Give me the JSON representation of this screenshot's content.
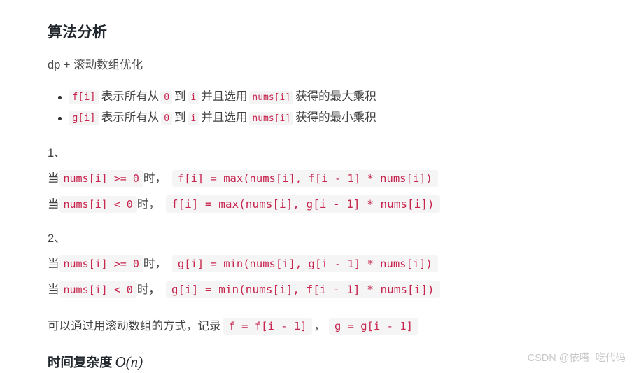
{
  "document": {
    "title": "算法分析",
    "subtitle": "dp + 滚动数组优化"
  },
  "definitions": [
    {
      "code": "f[i]",
      "text_1": "表示所有从",
      "code_from": "0",
      "text_2": "到",
      "code_to": "i",
      "text_3": "并且选用",
      "code_use": "nums[i]",
      "text_4": "获得的最大乘积"
    },
    {
      "code": "g[i]",
      "text_1": "表示所有从",
      "code_from": "0",
      "text_2": "到",
      "code_to": "i",
      "text_3": "并且选用",
      "code_use": "nums[i]",
      "text_4": "获得的最小乘积"
    }
  ],
  "sections": [
    {
      "label": "1、",
      "cases": [
        {
          "prefix": "当",
          "condition": "nums[i] >= 0",
          "middle": "时，",
          "formula": "f[i] = max(nums[i], f[i - 1] * nums[i])"
        },
        {
          "prefix": "当",
          "condition": "nums[i] < 0",
          "middle": "时，",
          "formula": "f[i] = max(nums[i], g[i - 1] * nums[i])"
        }
      ]
    },
    {
      "label": "2、",
      "cases": [
        {
          "prefix": "当",
          "condition": "nums[i] >= 0",
          "middle": "时，",
          "formula": "g[i] = min(nums[i], g[i - 1] * nums[i])"
        },
        {
          "prefix": "当",
          "condition": "nums[i] < 0",
          "middle": "时，",
          "formula": "g[i] = min(nums[i], f[i - 1] * nums[i])"
        }
      ]
    }
  ],
  "closing": {
    "text_1": "可以通过用滚动数组的方式，记录",
    "code_f": "f = f[i - 1]",
    "separator": "，",
    "code_g": "g = g[i - 1]"
  },
  "complexity": {
    "label": "时间复杂度",
    "notation": "O(n)"
  },
  "watermark": {
    "text": "CSDN @依嗒_吃代码"
  },
  "colors": {
    "code_text": "#c7254e",
    "code_background": "#f4f4f4",
    "heading": "#22272e",
    "body_text": "#3f3f3f",
    "rule": "#ededed",
    "watermark": "#c9c9c9"
  }
}
